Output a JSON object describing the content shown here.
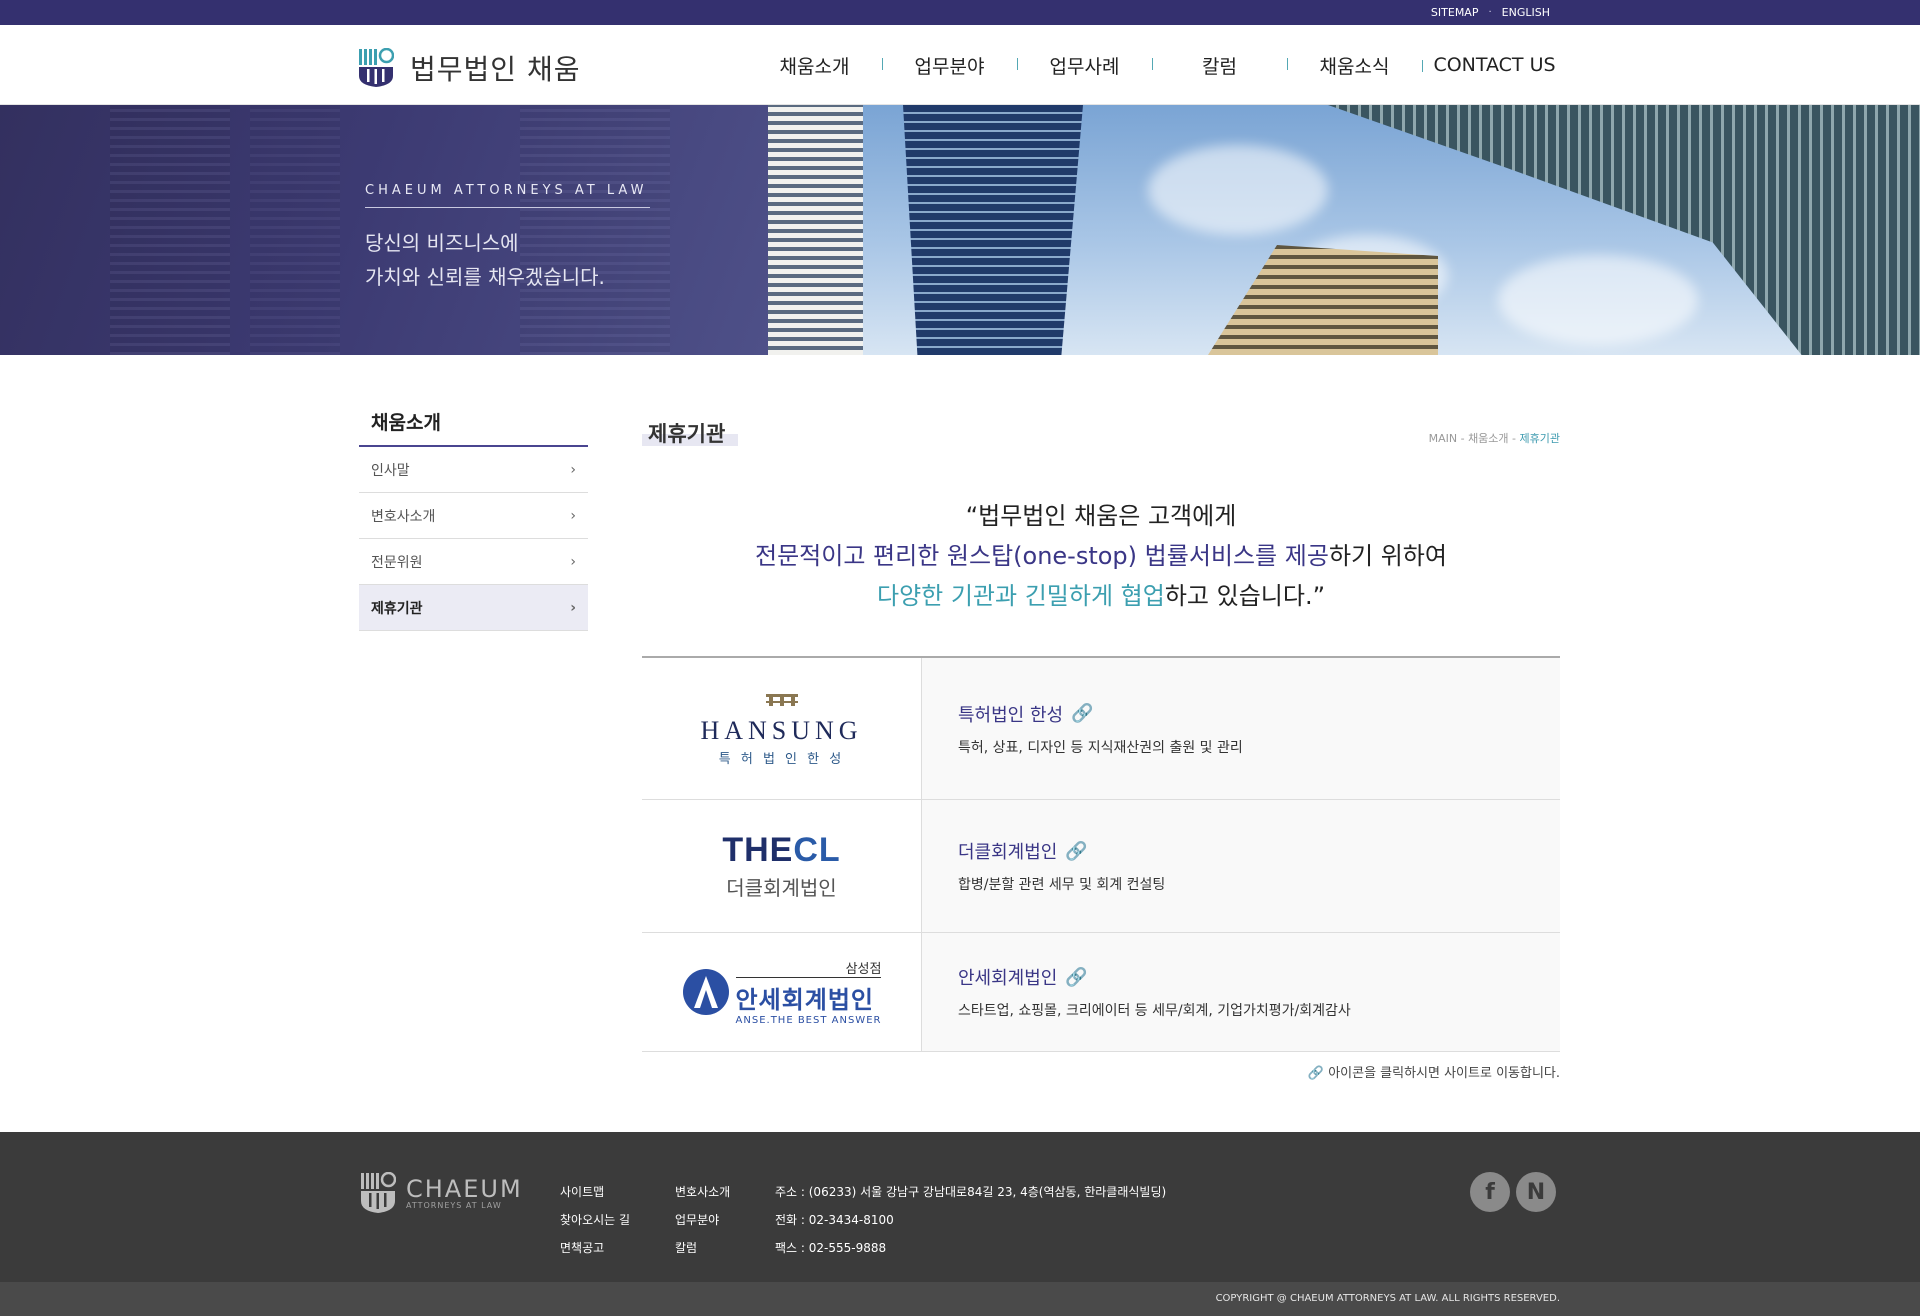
{
  "topbar": {
    "sitemap": "SITEMAP",
    "separator": "·",
    "english": "ENGLISH",
    "bg_color": "#34306f"
  },
  "header": {
    "logo_text": "법무법인 채움",
    "nav": [
      "채움소개",
      "업무분야",
      "업무사례",
      "칼럼",
      "채움소식",
      "CONTACT US"
    ]
  },
  "hero": {
    "eng": "CHAEUM ATTORNEYS AT LAW",
    "slogan_line1": "당신의 비즈니스에",
    "slogan_line2": "가치와 신뢰를 채우겠습니다."
  },
  "sidebar": {
    "title": "채움소개",
    "items": [
      {
        "label": "인사말",
        "active": false
      },
      {
        "label": "변호사소개",
        "active": false
      },
      {
        "label": "전문위원",
        "active": false
      },
      {
        "label": "제휴기관",
        "active": true
      }
    ],
    "chevron": "›"
  },
  "content": {
    "page_title": "제휴기관",
    "breadcrumb": {
      "main": "MAIN",
      "sep": " - ",
      "section": "채움소개",
      "current": "제휴기관"
    },
    "quote": {
      "l1": "“법무법인 채움은 고객에게",
      "l2_hl": "전문적이고 편리한 원스탑(one-stop) 법률서비스를 제공",
      "l2_rest": "하기 위하여",
      "l3_hl": "다양한 기관과 긴밀하게 협업",
      "l3_rest": "하고 있습니다.”"
    },
    "partners": [
      {
        "logo": {
          "main": "HANSUNG",
          "sub": "특 허 법 인  한 성"
        },
        "name": "특허법인 한성",
        "desc": "특허, 상표, 디자인 등 지식재산권의 출원 및 관리"
      },
      {
        "logo": {
          "main_a": "THE",
          "main_b": "CL",
          "sub": "더클회계법인"
        },
        "name": "더클회계법인",
        "desc": "합병/분할 관련 세무 및 회계 컨설팅"
      },
      {
        "logo": {
          "branch": "삼성점",
          "main": "안세회계법인",
          "sub": "ANSE.THE BEST ANSWER"
        },
        "name": "안세회계법인",
        "desc": "스타트업, 쇼핑몰, 크리에이터 등 세무/회계, 기업가치평가/회계감사"
      }
    ],
    "link_icon": "🔗",
    "note": "아이콘을 클릭하시면 사이트로 이동합니다."
  },
  "footer": {
    "logo_name": "CHAEUM",
    "logo_sub": "ATTORNEYS AT LAW",
    "col1": [
      "사이트맵",
      "찾아오시는 길",
      "면책공고"
    ],
    "col2": [
      "변호사소개",
      "업무분야",
      "칼럼"
    ],
    "address": "주소 : (06233) 서울 강남구 강남대로84길 23, 4층(역삼동, 한라클래식빌딩)",
    "phone": "전화 : 02-3434-8100",
    "fax": "팩스 : 02-555-9888",
    "social": [
      "f",
      "N"
    ],
    "copyright": "COPYRIGHT @ CHAEUM ATTORNEYS AT LAW. ALL RIGHTS RESERVED."
  },
  "colors": {
    "navy": "#3a3686",
    "teal": "#3c9fb0",
    "footer": "#3b3b3b"
  }
}
